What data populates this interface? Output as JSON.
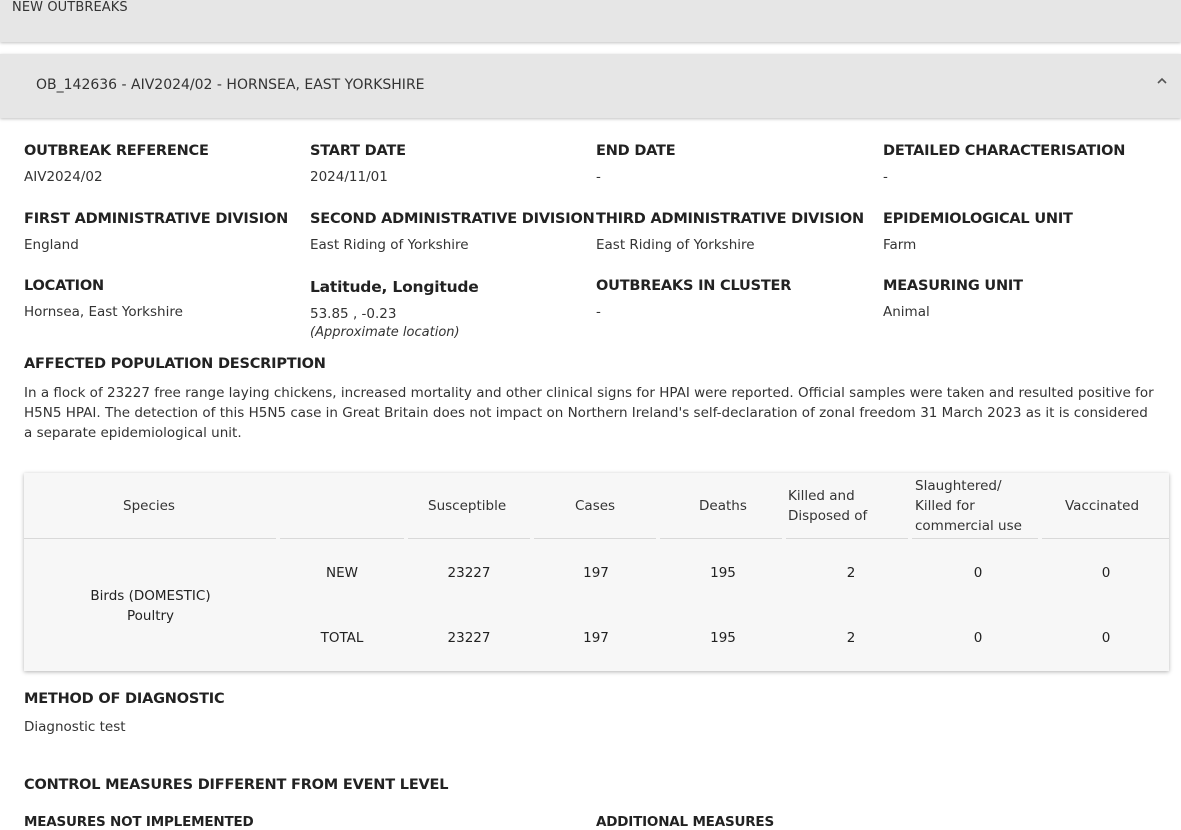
{
  "top_bar": {
    "label": "NEW OUTBREAKS"
  },
  "panel": {
    "title": "OB_142636 - AIV2024/02 - HORNSEA, EAST YORKSHIRE"
  },
  "fields": {
    "outbreak_reference": {
      "label": "OUTBREAK REFERENCE",
      "value": "AIV2024/02"
    },
    "start_date": {
      "label": "START DATE",
      "value": "2024/11/01"
    },
    "end_date": {
      "label": "END DATE",
      "value": "-"
    },
    "detailed_characterisation": {
      "label": "DETAILED CHARACTERISATION",
      "value": "-"
    },
    "first_admin": {
      "label": "FIRST ADMINISTRATIVE DIVISION",
      "value": "England"
    },
    "second_admin": {
      "label": "SECOND ADMINISTRATIVE DIVISION",
      "value": "East Riding of Yorkshire"
    },
    "third_admin": {
      "label": "THIRD ADMINISTRATIVE DIVISION",
      "value": "East Riding of Yorkshire"
    },
    "epi_unit": {
      "label": "EPIDEMIOLOGICAL UNIT",
      "value": "Farm"
    },
    "location": {
      "label": "LOCATION",
      "value": "Hornsea, East Yorkshire"
    },
    "lat_long": {
      "label": "Latitude, Longitude",
      "value": "53.85 , -0.23",
      "note": "(Approximate location)"
    },
    "outbreaks_in_cluster": {
      "label": "OUTBREAKS IN CLUSTER",
      "value": "-"
    },
    "measuring_unit": {
      "label": "MEASURING UNIT",
      "value": "Animal"
    }
  },
  "affected_population": {
    "label": "AFFECTED POPULATION DESCRIPTION",
    "text": "In a flock of 23227 free range laying chickens, increased mortality and other clinical signs for HPAI were reported. Official samples were taken and resulted positive for H5N5 HPAI. The detection of this H5N5 case in Great Britain does not impact on Northern Ireland's self-declaration of zonal freedom 31 March 2023 as it is considered a separate epidemiological unit."
  },
  "table": {
    "headers": {
      "species": "Species",
      "susceptible": "Susceptible",
      "cases": "Cases",
      "deaths": "Deaths",
      "killed_1": "Killed and",
      "killed_2": "Disposed of",
      "slaughtered_1": "Slaughtered/",
      "slaughtered_2": "Killed for",
      "slaughtered_3": "commercial use",
      "vaccinated": "Vaccinated"
    },
    "species_line1": "Birds (DOMESTIC)",
    "species_line2": "Poultry",
    "rows": [
      {
        "type": "NEW",
        "susceptible": "23227",
        "cases": "197",
        "deaths": "195",
        "killed": "2",
        "slaughtered": "0",
        "vaccinated": "0"
      },
      {
        "type": "TOTAL",
        "susceptible": "23227",
        "cases": "197",
        "deaths": "195",
        "killed": "2",
        "slaughtered": "0",
        "vaccinated": "0"
      }
    ]
  },
  "method_of_diagnostic": {
    "label": "METHOD OF DIAGNOSTIC",
    "value": "Diagnostic test"
  },
  "control_measures": {
    "label": "CONTROL MEASURES DIFFERENT FROM EVENT LEVEL",
    "not_implemented": "MEASURES NOT IMPLEMENTED",
    "additional": "ADDITIONAL MEASURES"
  },
  "icons": {
    "collapse": "chevron-up-icon"
  }
}
